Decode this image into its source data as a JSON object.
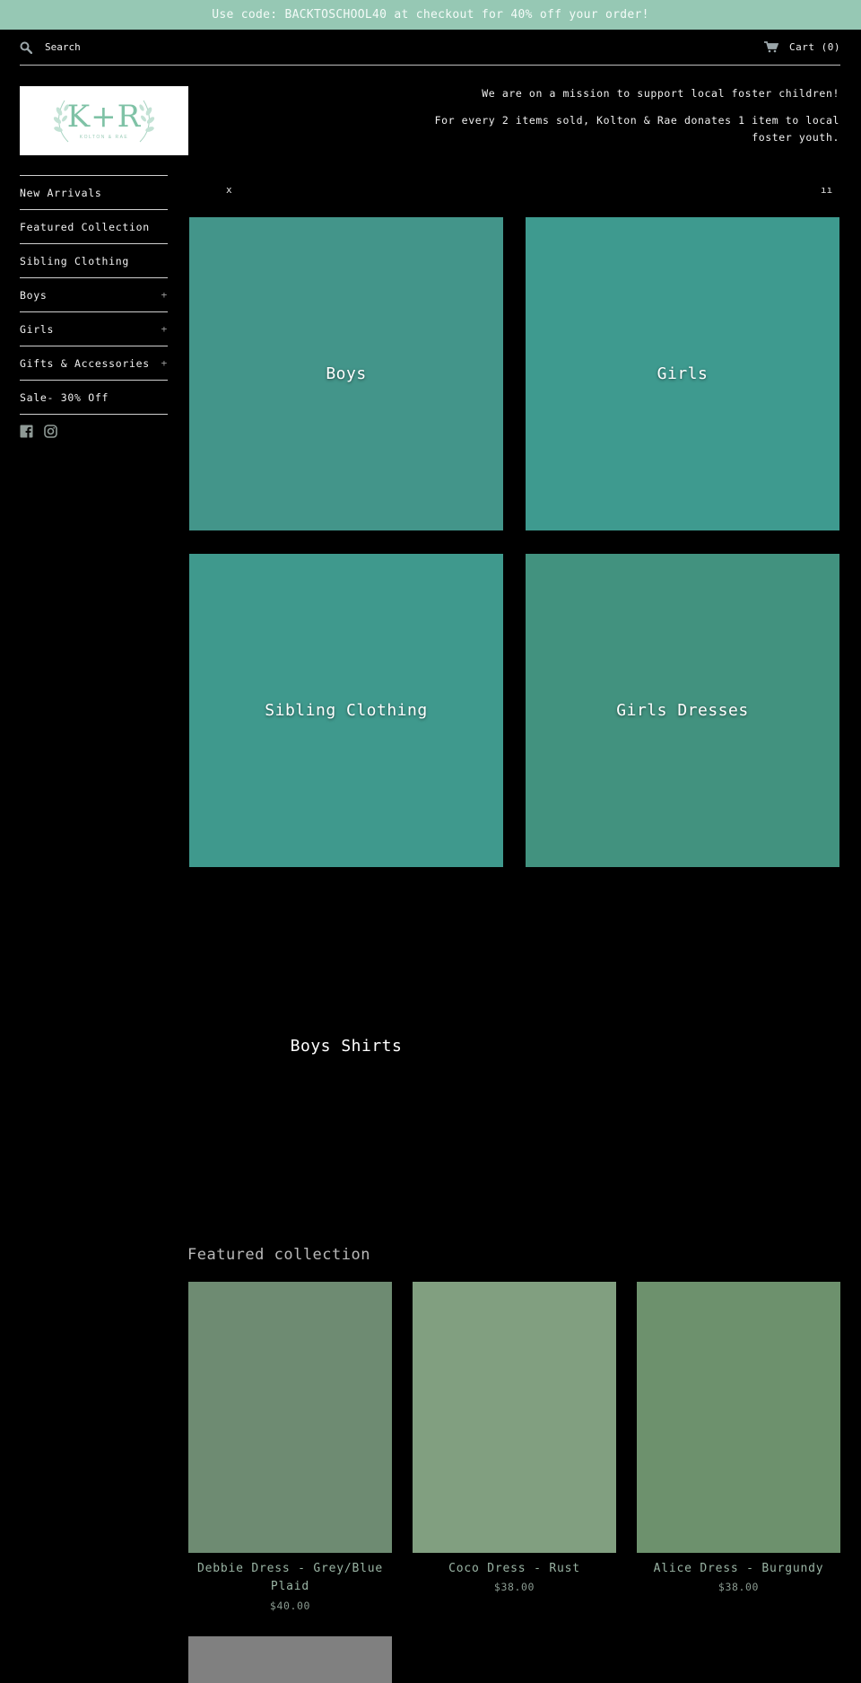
{
  "announcement": "Use code: BACKTOSCHOOL40 at checkout for 40% off your order!",
  "header": {
    "search_label": "Search",
    "cart_label": "Cart (0)",
    "search_icon": "search-icon",
    "cart_icon": "cart-icon"
  },
  "logo": {
    "mark": "K+R",
    "subtitle": "KOLTON & RAE"
  },
  "mission": {
    "line1": "We are on a mission to support local foster children!",
    "line2": "For every 2 items sold, Kolton & Rae donates 1 item to local foster youth."
  },
  "sidebar": {
    "items": [
      {
        "label": "New Arrivals",
        "expand": ""
      },
      {
        "label": "Featured Collection",
        "expand": ""
      },
      {
        "label": "Sibling Clothing",
        "expand": ""
      },
      {
        "label": "Boys",
        "expand": "+"
      },
      {
        "label": "Girls",
        "expand": "+"
      },
      {
        "label": "Gifts & Accessories",
        "expand": "+"
      },
      {
        "label": "Sale- 30% Off",
        "expand": ""
      }
    ],
    "social_icons": [
      "facebook-icon",
      "instagram-icon"
    ]
  },
  "slider": {
    "prev": "x",
    "next": "ıı"
  },
  "collections": [
    {
      "title": "Boys",
      "color": "#43958a"
    },
    {
      "title": "Girls",
      "color": "#3e9a8f"
    },
    {
      "title": "Sibling Clothing",
      "color": "#3f998d"
    },
    {
      "title": "Girls Dresses",
      "color": "#42927f"
    },
    {
      "title": "Boys Shirts",
      "color": "#000000"
    }
  ],
  "featured": {
    "title": "Featured collection",
    "products": [
      {
        "name": "Debbie Dress - Grey/Blue Plaid",
        "price": "$40.00",
        "color": "#6e8b72"
      },
      {
        "name": "Coco Dress - Rust",
        "price": "$38.00",
        "color": "#819f80"
      },
      {
        "name": "Alice Dress - Burgundy",
        "price": "$38.00",
        "color": "#6d916d"
      },
      {
        "name": "",
        "price": "",
        "color": "#808080"
      }
    ]
  }
}
